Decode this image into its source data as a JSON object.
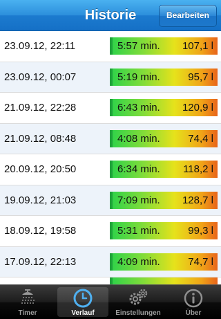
{
  "navbar": {
    "title": "Historie",
    "edit_label": "Bearbeiten"
  },
  "history": [
    {
      "date": "23.09.12, 22:11",
      "duration": "5:57 min.",
      "volume": "107,1 l",
      "level": 1.0
    },
    {
      "date": "23.09.12, 00:07",
      "duration": "5:19 min.",
      "volume": "95,7 l",
      "level": 1.0
    },
    {
      "date": "21.09.12, 22:28",
      "duration": "6:43 min.",
      "volume": "120,9 l",
      "level": 1.0
    },
    {
      "date": "21.09.12, 08:48",
      "duration": "4:08 min.",
      "volume": "74,4 l",
      "level": 1.0
    },
    {
      "date": "20.09.12, 20:50",
      "duration": "6:34 min.",
      "volume": "118,2 l",
      "level": 1.0
    },
    {
      "date": "19.09.12, 21:03",
      "duration": "7:09 min.",
      "volume": "128,7 l",
      "level": 1.0
    },
    {
      "date": "18.09.12, 19:58",
      "duration": "5:31 min.",
      "volume": "99,3 l",
      "level": 1.0
    },
    {
      "date": "17.09.12, 22:13",
      "duration": "4:09 min.",
      "volume": "74,7 l",
      "level": 1.0
    },
    {
      "date": "",
      "duration": "",
      "volume": "",
      "level": 1.0
    }
  ],
  "tabbar": {
    "tabs": [
      {
        "label": "Timer",
        "icon": "shower-icon"
      },
      {
        "label": "Verlauf",
        "icon": "clock-icon",
        "active": true
      },
      {
        "label": "Einstellungen",
        "icon": "gears-icon"
      },
      {
        "label": "Über",
        "icon": "info-icon"
      }
    ]
  }
}
